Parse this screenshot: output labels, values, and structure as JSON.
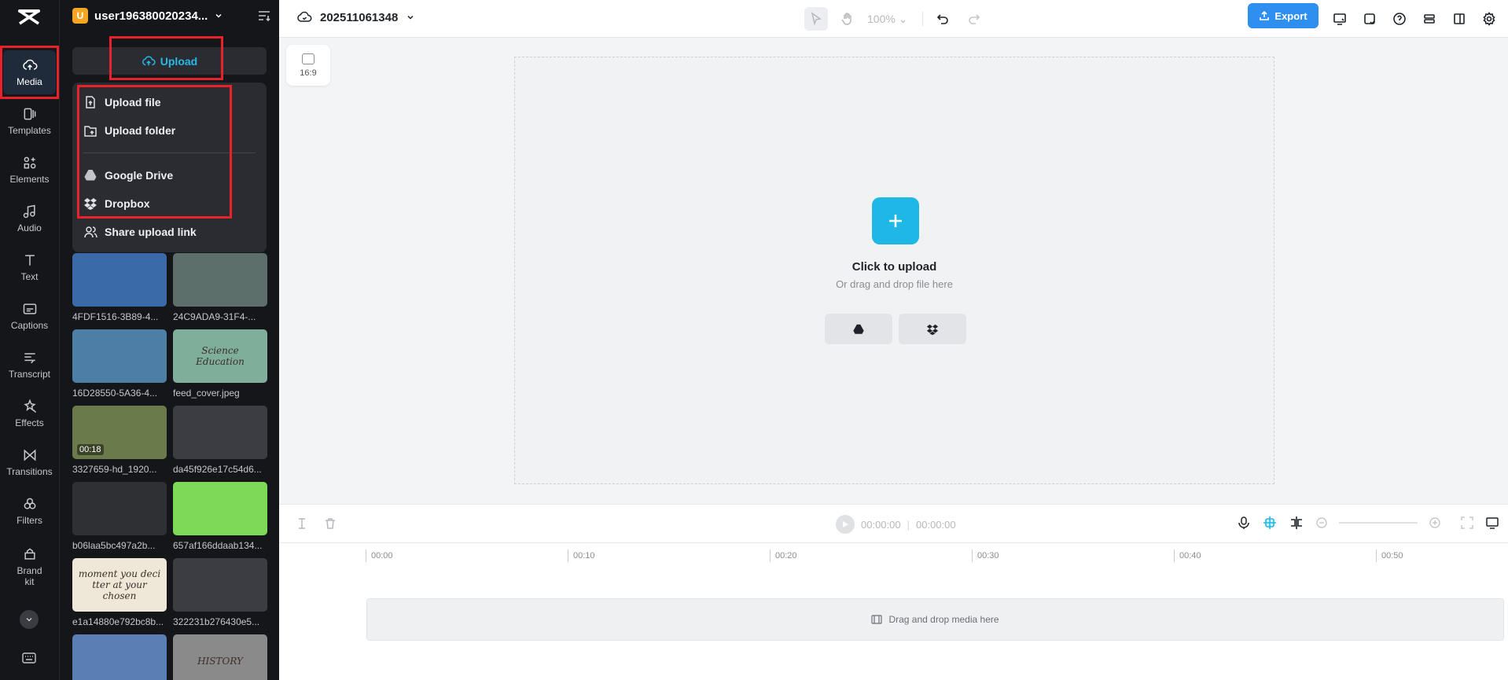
{
  "app": {
    "logo": "capcut-logo"
  },
  "rail": {
    "items": [
      {
        "label": "Media",
        "icon": "cloud-upload-icon",
        "active": true
      },
      {
        "label": "Templates",
        "icon": "templates-icon"
      },
      {
        "label": "Elements",
        "icon": "elements-icon"
      },
      {
        "label": "Audio",
        "icon": "music-note-icon"
      },
      {
        "label": "Text",
        "icon": "text-icon"
      },
      {
        "label": "Captions",
        "icon": "captions-icon"
      },
      {
        "label": "Transcript",
        "icon": "transcript-icon"
      },
      {
        "label": "Effects",
        "icon": "effects-icon"
      },
      {
        "label": "Transitions",
        "icon": "transitions-icon"
      },
      {
        "label": "Filters",
        "icon": "filters-icon"
      },
      {
        "label": "Brand kit",
        "icon": "brand-kit-icon"
      }
    ]
  },
  "panel": {
    "avatar_letter": "U",
    "username": "user19638002023​4...",
    "upload_label": "Upload",
    "menu": {
      "upload_file": "Upload file",
      "upload_folder": "Upload folder",
      "google_drive": "Google Drive",
      "dropbox": "Dropbox",
      "share_link": "Share upload link"
    },
    "media": [
      {
        "name": "4FDF1516-3B89-4...",
        "thumb": "#3a6aa8"
      },
      {
        "name": "24C9ADA9-31F4-...",
        "thumb": "#5c6f6a"
      },
      {
        "name": "16D28550-5A36-4...",
        "thumb": "#4c7ea6"
      },
      {
        "name": "feed_cover.jpeg",
        "thumb": "#7fae9b",
        "overlay": "Science Education"
      },
      {
        "name": "3327659-hd_1920...",
        "thumb": "#6b7a4a",
        "duration": "00:18"
      },
      {
        "name": "da45f926e17c54d6...",
        "thumb": "#3b3d42"
      },
      {
        "name": "b06laa5bc497a2b...",
        "thumb": "#2f3034"
      },
      {
        "name": "657af166ddaab134...",
        "thumb": "#7ed957"
      },
      {
        "name": "e1a14880e792bc8b...",
        "thumb": "#efe7d8",
        "overlay": "moment you deci tter at your chosen"
      },
      {
        "name": "322231b276430e5...",
        "thumb": "#3b3d42"
      },
      {
        "name": "",
        "thumb": "#5a7fb5"
      },
      {
        "name": "",
        "thumb": "#8a8a8a",
        "overlay": "HISTORY"
      }
    ]
  },
  "topbar": {
    "project_name": "202511061348",
    "zoom": "100%",
    "export_label": "Export"
  },
  "canvas": {
    "ratio_label": "16:9",
    "click_title": "Click to upload",
    "click_sub": "Or drag and drop file here"
  },
  "player": {
    "current_time": "00:00:00",
    "total_time": "00:00:00"
  },
  "timeline": {
    "ticks": [
      "00:00",
      "00:10",
      "00:20",
      "00:30",
      "00:40",
      "00:50"
    ],
    "drop_label": "Drag and drop media here"
  },
  "colors": {
    "accent": "#1fb8e6",
    "export": "#2f8ff0",
    "highlight": "#e8212a"
  }
}
